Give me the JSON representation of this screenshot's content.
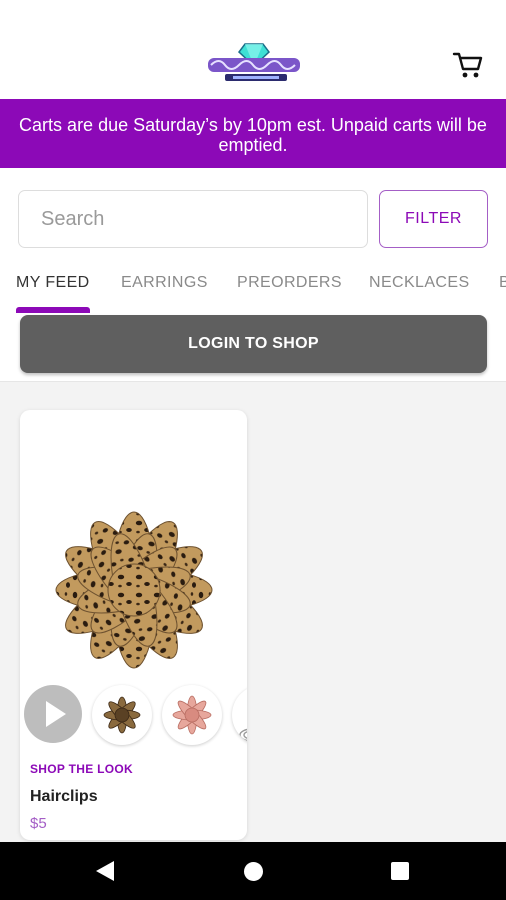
{
  "header": {
    "logo_icon": "brand-logo-diamond",
    "cart_icon": "shopping-cart-icon"
  },
  "banner": {
    "text": "Carts are due Saturday’s by 10pm est. Unpaid carts will be emptied."
  },
  "search": {
    "placeholder": "Search"
  },
  "filter": {
    "label": "FILTER"
  },
  "tabs": [
    {
      "label": "MY FEED",
      "active": true
    },
    {
      "label": "EARRINGS",
      "active": false
    },
    {
      "label": "PREORDERS",
      "active": false
    },
    {
      "label": "NECKLACES",
      "active": false
    },
    {
      "label": "B",
      "active": false
    }
  ],
  "login": {
    "label": "LOGIN TO SHOP"
  },
  "product": {
    "shop_look": "SHOP THE LOOK",
    "name": "Hairclips",
    "price": "$5"
  },
  "colors": {
    "accent": "#8c09b7",
    "button_dark": "#5f5f5f",
    "feed_bg": "#f3f3f3"
  },
  "navbar": {
    "back_icon": "nav-back-icon",
    "home_icon": "nav-home-icon",
    "recent_icon": "nav-recent-apps-icon"
  }
}
